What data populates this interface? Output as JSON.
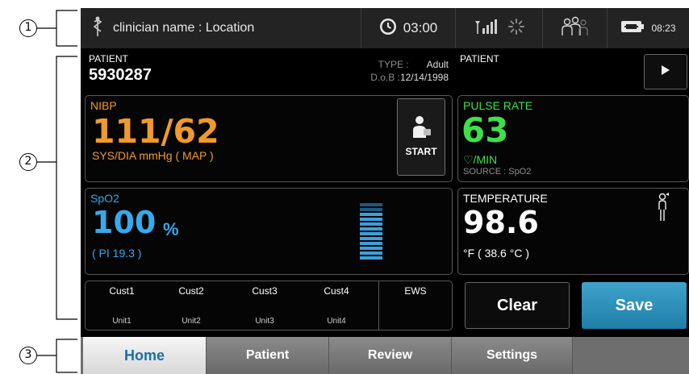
{
  "callouts": [
    "1",
    "2",
    "3"
  ],
  "status_bar": {
    "clinician_text": "clinician name : Location",
    "timer_value": "03:00",
    "battery_time": "08:23"
  },
  "patient": {
    "label": "PATIENT",
    "id": "5930287",
    "type_label": "TYPE :",
    "type_value": "Adult",
    "dob_label": "D.o.B :",
    "dob_value": "12/14/1998",
    "right_label": "PATIENT"
  },
  "nibp": {
    "title": "NIBP",
    "value": "111/62",
    "unit": "SYS/DIA mmHg ( MAP )",
    "start_label": "START",
    "color": "#f09a2c"
  },
  "pulse_rate": {
    "title": "PULSE RATE",
    "value": "63",
    "unit": "♡/MIN",
    "source": "SOURCE : SpO2",
    "color": "#3ee04a"
  },
  "spo2": {
    "title": "SpO2",
    "value": "100",
    "unit": "%",
    "pi": "( PI 19.3 )",
    "color": "#37a9ec"
  },
  "temperature": {
    "title": "TEMPERATURE",
    "value": "98.6",
    "unit": "°F   ( 38.6 °C )"
  },
  "custom": [
    {
      "name": "Cust1",
      "unit": "Unit1"
    },
    {
      "name": "Cust2",
      "unit": "Unit2"
    },
    {
      "name": "Cust3",
      "unit": "Unit3"
    },
    {
      "name": "Cust4",
      "unit": "Unit4"
    }
  ],
  "ews_label": "EWS",
  "actions": {
    "clear_label": "Clear",
    "save_label": "Save",
    "save_color": "#2a8fbd"
  },
  "tabs": [
    {
      "label": "Home",
      "active": true
    },
    {
      "label": "Patient",
      "active": false
    },
    {
      "label": "Review",
      "active": false
    },
    {
      "label": "Settings",
      "active": false
    }
  ],
  "icons": {
    "status_bar": [
      "caduceus-icon",
      "clock-icon",
      "signal-icon",
      "spinner-icon",
      "people-icon",
      "battery-icon"
    ],
    "other": [
      "play-icon",
      "nibp-cuff-person-icon",
      "temperature-probe-icon"
    ]
  }
}
